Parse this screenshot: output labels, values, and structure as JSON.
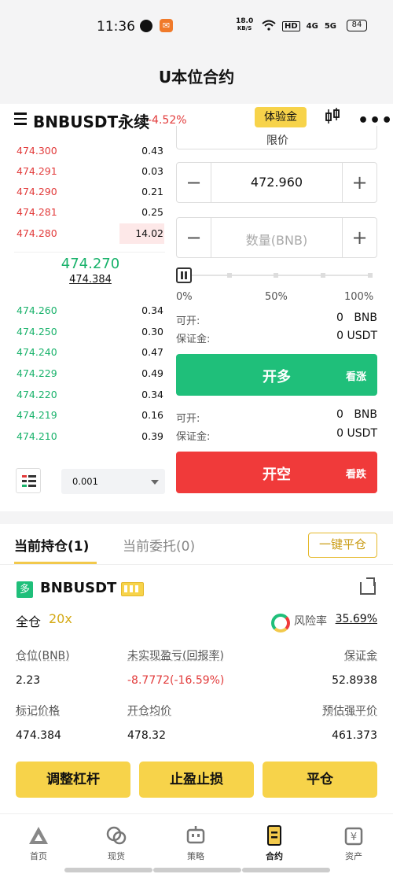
{
  "status_bar": {
    "time": "11:36",
    "net_speed": "18.0",
    "net_unit": "KB/S",
    "hd": "HD",
    "net1": "4G",
    "net2": "5G",
    "battery": "84"
  },
  "page_title": "U本位合约",
  "symbol": {
    "name": "BNBUSDT永续",
    "change": "-4.52%",
    "trial_label": "体验金"
  },
  "order_book": {
    "asks": [
      {
        "price": "474.300",
        "qty": "0.43"
      },
      {
        "price": "474.291",
        "qty": "0.03"
      },
      {
        "price": "474.290",
        "qty": "0.21"
      },
      {
        "price": "474.281",
        "qty": "0.25"
      },
      {
        "price": "474.280",
        "qty": "14.02"
      }
    ],
    "last_price": "474.270",
    "mark_price": "474.384",
    "bids": [
      {
        "price": "474.260",
        "qty": "0.34"
      },
      {
        "price": "474.250",
        "qty": "0.30"
      },
      {
        "price": "474.240",
        "qty": "0.47"
      },
      {
        "price": "474.229",
        "qty": "0.49"
      },
      {
        "price": "474.220",
        "qty": "0.34"
      },
      {
        "price": "474.219",
        "qty": "0.16"
      },
      {
        "price": "474.210",
        "qty": "0.39"
      }
    ],
    "step": "0.001"
  },
  "order_form": {
    "order_type": "限价",
    "price_value": "472.960",
    "qty_placeholder": "数量(BNB)",
    "slider": {
      "value_percent": 0,
      "labels": [
        "0%",
        "50%",
        "100%"
      ]
    },
    "long": {
      "avail_label": "可开:",
      "avail_value": "0",
      "avail_unit": "BNB",
      "margin_label": "保证金:",
      "margin_value": "0 USDT",
      "button": "开多",
      "button_sub": "看涨"
    },
    "short": {
      "avail_label": "可开:",
      "avail_value": "0",
      "avail_unit": "BNB",
      "margin_label": "保证金:",
      "margin_value": "0 USDT",
      "button": "开空",
      "button_sub": "看跌"
    }
  },
  "positions": {
    "tabs": [
      "当前持仓(1)",
      "当前委托(0)"
    ],
    "close_all": "一键平仓",
    "item": {
      "side": "多",
      "symbol": "BNBUSDT",
      "margin_mode": "全仓",
      "leverage": "20x",
      "risk_label": "风险率",
      "risk_value": "35.69%",
      "stats": [
        {
          "label": "仓位(BNB)",
          "value": "2.23"
        },
        {
          "label": "未实现盈亏(回报率)",
          "value": "-8.7772(-16.59%)"
        },
        {
          "label": "保证金",
          "value": "52.8938"
        },
        {
          "label": "标记价格",
          "value": "474.384"
        },
        {
          "label": "开仓均价",
          "value": "478.32"
        },
        {
          "label": "预估强平价",
          "value": "461.373"
        }
      ],
      "actions": [
        "调整杠杆",
        "止盈止损",
        "平仓"
      ]
    }
  },
  "bottom_nav": [
    {
      "label": "首页",
      "icon": "home-icon"
    },
    {
      "label": "现货",
      "icon": "spot-icon"
    },
    {
      "label": "策略",
      "icon": "robot-icon"
    },
    {
      "label": "合约",
      "icon": "futures-icon",
      "active": true
    },
    {
      "label": "资产",
      "icon": "assets-icon"
    }
  ]
}
